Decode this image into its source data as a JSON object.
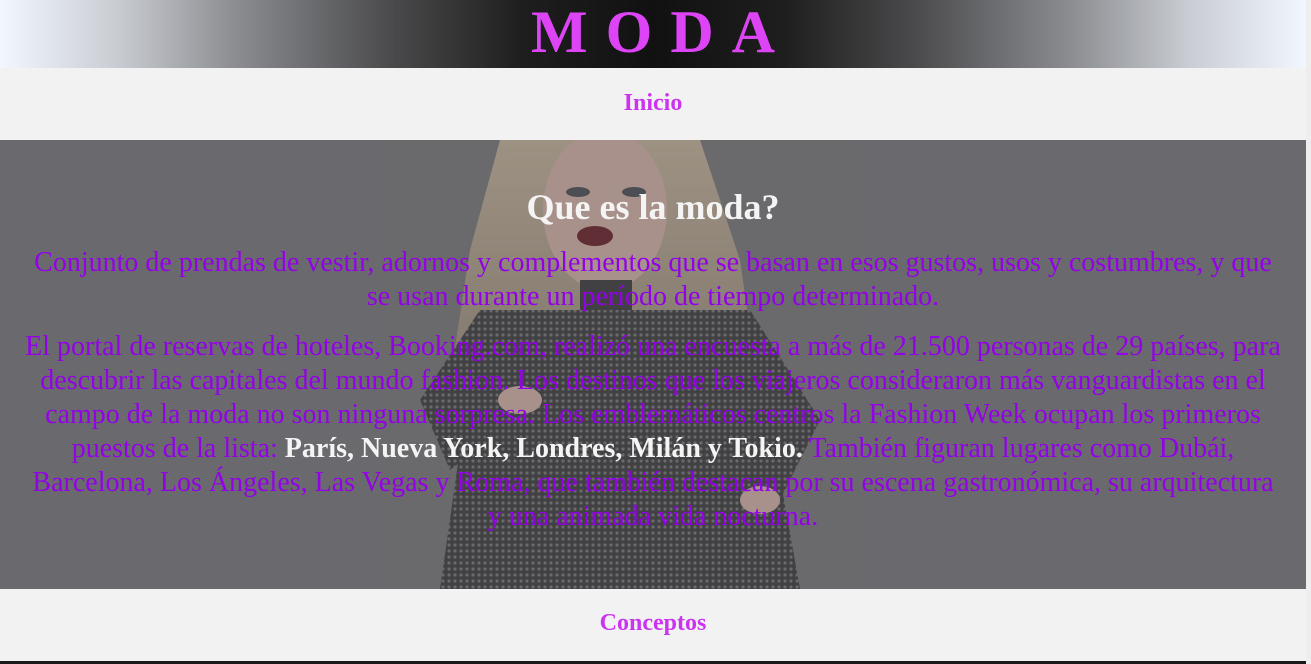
{
  "header": {
    "logo_text": "MODA"
  },
  "nav_top": {
    "link": "Inicio"
  },
  "hero": {
    "heading": "Que es la moda?",
    "paragraph1": "Conjunto de prendas de vestir, adornos y complementos que se basan en esos gustos, usos y costumbres, y que se usan durante un período de tiempo determinado.",
    "paragraph2_part1": "El portal de reservas de hoteles, Booking.com, realizó una encuesta a más de 21.500 personas de 29 países, para descubrir las capitales del mundo fashion. Los destinos que los viajeros consideraron más vanguardistas en el campo de la moda no son ninguna sorpresa. Los emblemáticos centros la Fashion Week ocupan los primeros puestos de la lista:",
    "paragraph2_bold": "París, Nueva York, Londres, Milán y Tokio.",
    "paragraph2_part2": "También figuran lugares como Dubái, Barcelona, Los Ángeles, Las Vegas y Roma, que también destacan por su escena gastronómica, su arquitectura y una animada vida nocturna.",
    "background_image": "fashion-model-photo"
  },
  "nav_bottom": {
    "link": "Conceptos"
  },
  "colors": {
    "accent_magenta": "#dd44f5",
    "nav_link": "#cc33f0",
    "paragraph_purple": "#9400e8",
    "heading_white": "#f4f4f4",
    "hero_overlay": "#6a6a6e",
    "nav_background": "#f2f2f2"
  }
}
